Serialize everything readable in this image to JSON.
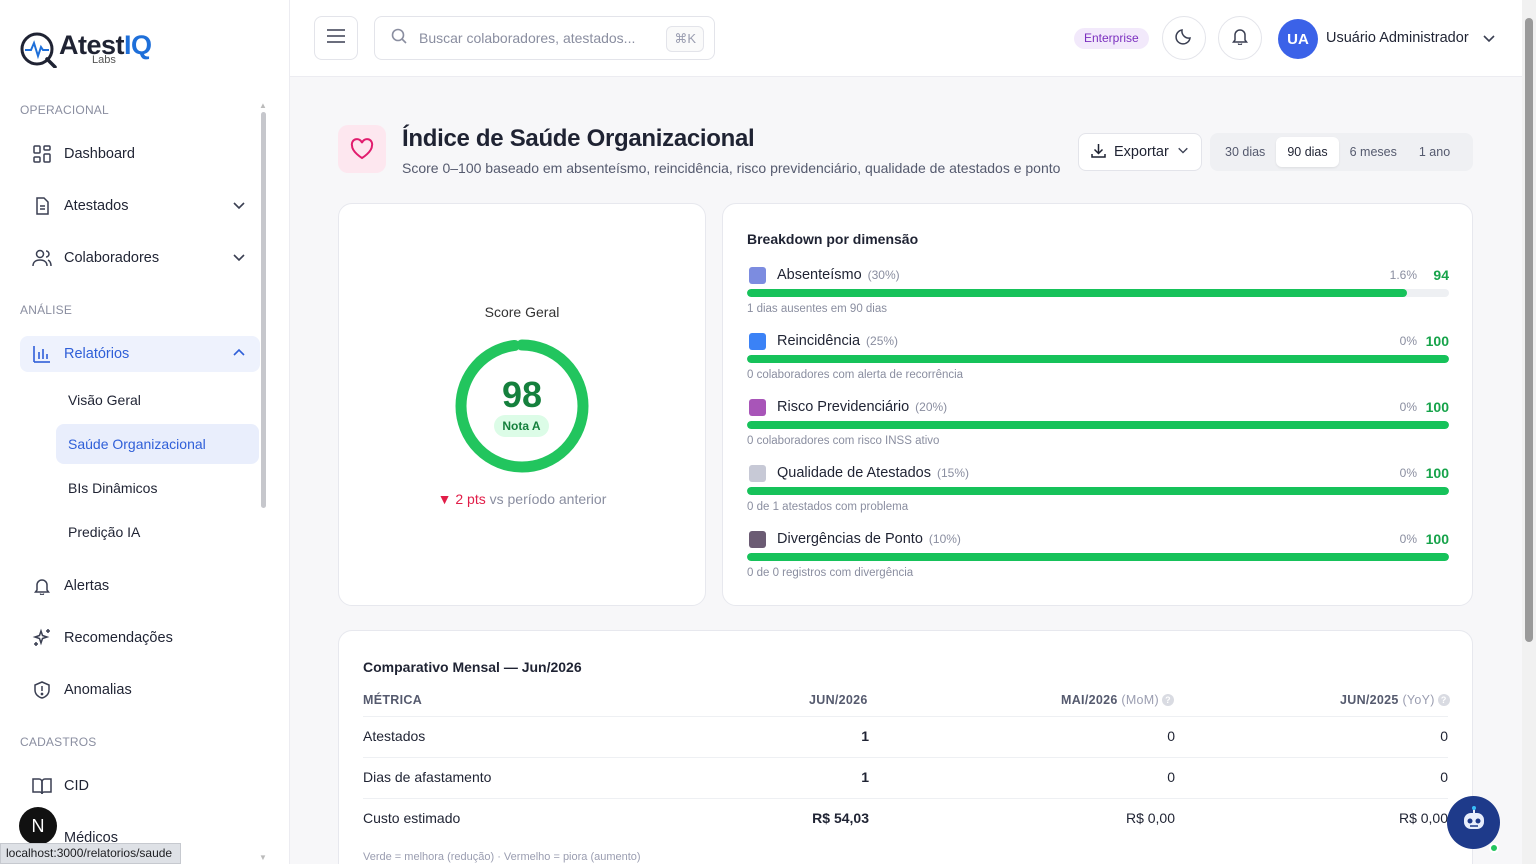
{
  "brand": {
    "name_main": "Atest",
    "name_accent": "IQ",
    "sub": "Labs"
  },
  "sidebar": {
    "sections": {
      "operational": "OPERACIONAL",
      "analysis": "ANÁLISE",
      "records": "CADASTROS"
    },
    "items": {
      "dashboard": "Dashboard",
      "atestados": "Atestados",
      "colaboradores": "Colaboradores",
      "relatorios": "Relatórios",
      "alertas": "Alertas",
      "recomendacoes": "Recomendações",
      "anomalias": "Anomalias",
      "cid": "CID",
      "medicos": "Médicos"
    },
    "sub_items": [
      "Visão Geral",
      "Saúde Organizacional",
      "BIs Dinâmicos",
      "Predição IA"
    ],
    "badge_letter": "N",
    "status_url": "localhost:3000/relatorios/saude"
  },
  "header": {
    "search_placeholder": "Buscar colaboradores, atestados...",
    "shortcut": "⌘K",
    "plan": "Enterprise",
    "avatar_initials": "UA",
    "user_name": "Usuário Administrador"
  },
  "page": {
    "title": "Índice de Saúde Organizacional",
    "subtitle": "Score 0–100 baseado em absenteísmo, reincidência, risco previdenciário, qualidade de atestados e ponto",
    "export_label": "Exportar",
    "ranges": [
      "30 dias",
      "90 dias",
      "6 meses",
      "1 ano"
    ],
    "active_range": "90 dias"
  },
  "score": {
    "label": "Score Geral",
    "value": "98",
    "grade": "Nota A",
    "delta_value": "▼ 2 pts",
    "delta_text": "vs período anterior",
    "fraction": 0.98
  },
  "breakdown": {
    "title": "Breakdown por dimensão",
    "dimensions": [
      {
        "name": "Absenteísmo",
        "weight": "(30%)",
        "pct": "1.6%",
        "score": "94",
        "fill": 0.94,
        "note": "1 dias ausentes em 90 dias",
        "icon": "calendar-icon",
        "color": "#7c8ce0"
      },
      {
        "name": "Reincidência",
        "weight": "(25%)",
        "pct": "0%",
        "score": "100",
        "fill": 1.0,
        "note": "0 colaboradores com alerta de recorrência",
        "icon": "repeat-icon",
        "color": "#3b82f6"
      },
      {
        "name": "Risco Previdenciário",
        "weight": "(20%)",
        "pct": "0%",
        "score": "100",
        "fill": 1.0,
        "note": "0 colaboradores com risco INSS ativo",
        "icon": "book-icon",
        "color": "#a855b8"
      },
      {
        "name": "Qualidade de Atestados",
        "weight": "(15%)",
        "pct": "0%",
        "score": "100",
        "fill": 1.0,
        "note": "0 de 1 atestados com problema",
        "icon": "document-icon",
        "color": "#c7c9d6"
      },
      {
        "name": "Divergências de Ponto",
        "weight": "(10%)",
        "pct": "0%",
        "score": "100",
        "fill": 1.0,
        "note": "0 de 0 registros com divergência",
        "icon": "stopwatch-icon",
        "color": "#6b5b73"
      }
    ]
  },
  "comparison": {
    "title": "Comparativo Mensal — Jun/2026",
    "headers": {
      "metric": "MÉTRICA",
      "current": "JUN/2026",
      "mom": "MAI/2026",
      "mom_tag": "(MoM)",
      "yoy": "JUN/2025",
      "yoy_tag": "(YoY)",
      "help": "?"
    },
    "rows": [
      {
        "metric": "Atestados",
        "current": "1",
        "mom": "0",
        "yoy": "0"
      },
      {
        "metric": "Dias de afastamento",
        "current": "1",
        "mom": "0",
        "yoy": "0"
      },
      {
        "metric": "Custo estimado",
        "current": "R$ 54,03",
        "mom": "R$ 0,00",
        "yoy": "R$ 0,00"
      }
    ],
    "legend": "Verde = melhora (redução) · Vermelho = piora (aumento)"
  }
}
